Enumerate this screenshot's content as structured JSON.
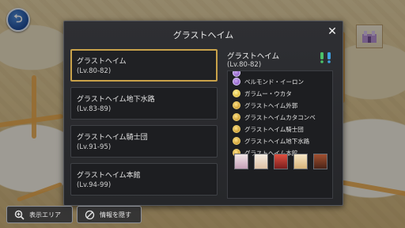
{
  "dialog": {
    "title": "グラストヘイム",
    "close_label": "✕"
  },
  "dungeons": [
    {
      "name": "グラストヘイム",
      "level": "(Lv.80-82)",
      "selected": true
    },
    {
      "name": "グラストヘイム地下水路",
      "level": "(Lv.83-89)",
      "selected": false
    },
    {
      "name": "グラストヘイム騎士団",
      "level": "(Lv.91-95)",
      "selected": false
    },
    {
      "name": "グラストヘイム本館",
      "level": "(Lv.94-99)",
      "selected": false
    }
  ],
  "detail": {
    "name": "グラストヘイム",
    "level": "(Lv.80-82)",
    "monsters": [
      {
        "name": "ベルモンド・イーロン",
        "icon": "purple-boss-icon"
      },
      {
        "name": "ガラムー・ウカタ",
        "icon": "yellow-monster-icon"
      },
      {
        "name": "グラストヘイム外郭",
        "icon": "dungeon-icon"
      },
      {
        "name": "グラストヘイムカタコンベ",
        "icon": "dungeon-icon"
      },
      {
        "name": "グラストヘイム騎士団",
        "icon": "dungeon-icon"
      },
      {
        "name": "グラストヘイム地下水路",
        "icon": "dungeon-icon"
      },
      {
        "name": "グラストヘイム本館",
        "icon": "dungeon-icon"
      }
    ]
  },
  "bottom": {
    "area_button": "表示エリア",
    "hide_button": "情報を隠す"
  },
  "colors": {
    "accent_border": "#c9a24a",
    "dialog_bg": "#2e2f33",
    "quest_icon": "#4bc26a"
  }
}
